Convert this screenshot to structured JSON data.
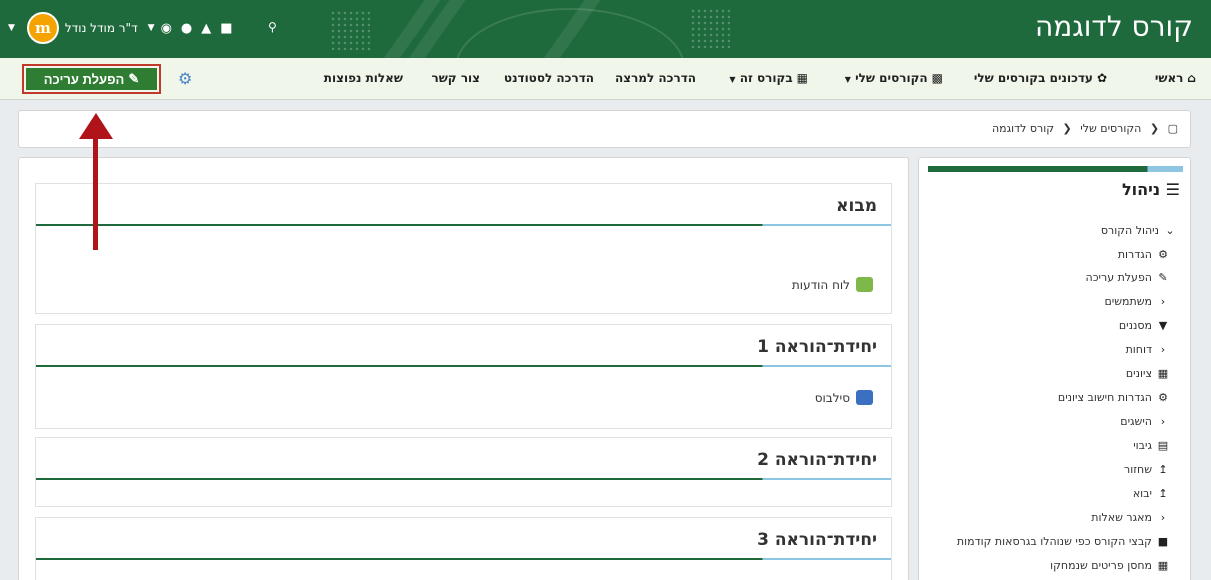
{
  "header": {
    "site_title": "קורס לדוגמה",
    "user_name": "ד\"ר מודל נודל",
    "avatar_letter": "m"
  },
  "nav": {
    "home": "ראשי",
    "course_updates": "עדכונים בקורסים שלי",
    "my_courses": "הקורסים שלי",
    "this_course": "בקורס זה",
    "lecturer_guide": "הדרכה למרצה",
    "student_guide": "הדרכה לסטודנט",
    "contact": "צור קשר",
    "faq": "שאלות נפוצות",
    "edit_mode": "הפעלת עריכה"
  },
  "breadcrumb": {
    "my_courses": "הקורסים שלי",
    "current": "קורס לדוגמה"
  },
  "sections": [
    {
      "title": "מבוא",
      "activity": "לוח הודעות"
    },
    {
      "title": "יחידת־הוראה 1",
      "activity": "סילבוס"
    },
    {
      "title": "יחידת־הוראה 2"
    },
    {
      "title": "יחידת־הוראה 3"
    }
  ],
  "admin": {
    "title": "ניהול",
    "items": [
      "ניהול הקורס",
      "הגדרות",
      "הפעלת עריכה",
      "משתמשים",
      "מסננים",
      "דוחות",
      "ציונים",
      "הגדרות חישוב ציונים",
      "הישגים",
      "גיבוי",
      "שחזור",
      "יבוא",
      "מאגר שאלות",
      "קבצי הקורס כפי שנוהלו בגרסאות קודמות",
      "מחסן פריטים שנמחקו"
    ]
  },
  "colors": {
    "brand_green": "#1f6a3d",
    "edit_button": "#2e7d32",
    "accent_blue": "#8ec5e0",
    "annotation_red": "#b0141a"
  }
}
